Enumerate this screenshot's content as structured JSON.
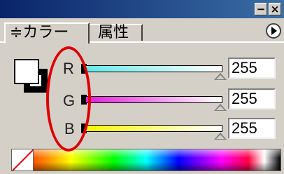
{
  "titlebar": {
    "minimize_glyph": "−",
    "close_glyph": "×"
  },
  "tabs": {
    "active_label": "≑カラー",
    "inactive_label": "属性"
  },
  "menu": {
    "icon": "play-triangle-icon"
  },
  "sliders": [
    {
      "label": "R",
      "value": "255",
      "color": "#66e8e8"
    },
    {
      "label": "G",
      "value": "255",
      "color": "#e020d8"
    },
    {
      "label": "B",
      "value": "255",
      "color": "#f8f800"
    }
  ],
  "colors": {
    "fill": "#ffffff",
    "stroke": "#000000",
    "annotation": "#e00000"
  }
}
